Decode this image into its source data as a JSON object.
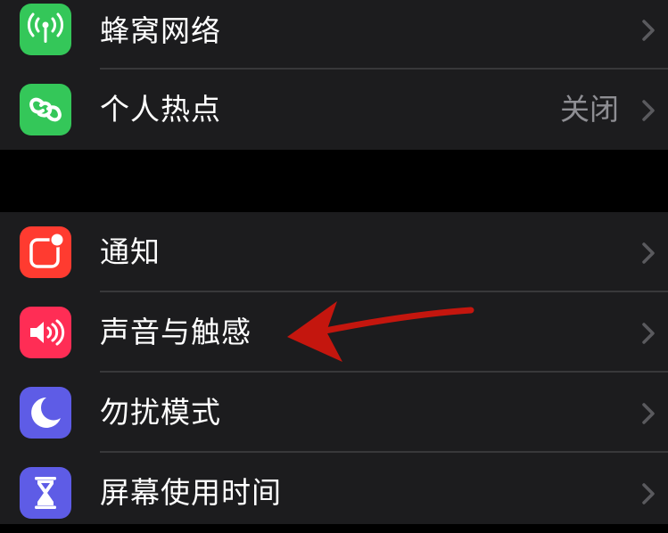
{
  "colors": {
    "background": "#000000",
    "group": "#1c1c1e",
    "separator": "#38383a",
    "label": "#ffffff",
    "value": "#8e8e93",
    "chevron": "#5a5a5e",
    "annotation_arrow": "#c4160e"
  },
  "network": [
    {
      "label": "蜂窝网络",
      "icon": "antenna-icon",
      "icon_color": "#34c759"
    },
    {
      "label": "个人热点",
      "icon": "link-chain-icon",
      "icon_color": "#34c759",
      "value": "关闭"
    }
  ],
  "system": [
    {
      "label": "通知",
      "icon": "notification-icon",
      "icon_color": "#ff3b30"
    },
    {
      "label": "声音与触感",
      "icon": "speaker-icon",
      "icon_color": "#ff2d55"
    },
    {
      "label": "勿扰模式",
      "icon": "moon-icon",
      "icon_color": "#5e5ce6"
    },
    {
      "label": "屏幕使用时间",
      "icon": "hourglass-icon",
      "icon_color": "#5e5ce6"
    }
  ]
}
